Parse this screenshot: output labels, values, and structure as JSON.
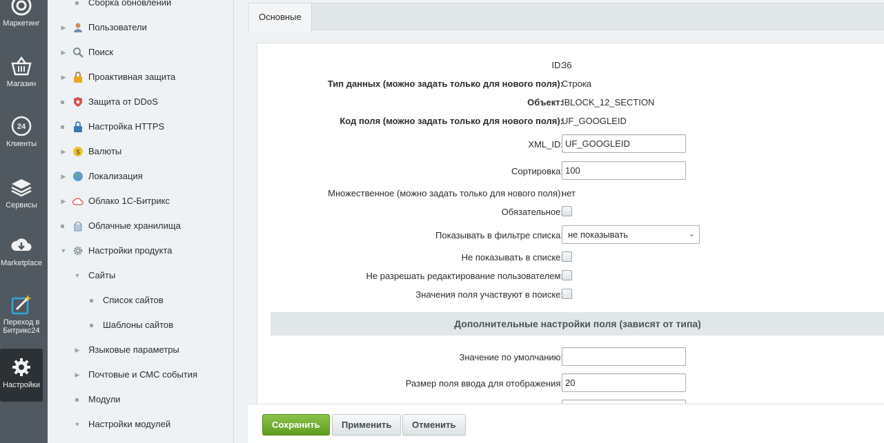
{
  "rail": [
    {
      "label": "Маркетинг",
      "icon": "target-icon"
    },
    {
      "label": "Магазин",
      "icon": "basket-icon"
    },
    {
      "label": "Клиенты",
      "icon": "clients-24-icon"
    },
    {
      "label": "Сервисы",
      "icon": "layers-icon"
    },
    {
      "label": "Marketplace",
      "icon": "cloud-download-icon"
    },
    {
      "label_line1": "Переход в",
      "label_line2": "Битрикс24",
      "icon": "magic-wand-icon"
    },
    {
      "label": "Настройки",
      "icon": "gear-icon",
      "active": true
    }
  ],
  "tree": [
    {
      "label": "Сборка обновлений"
    },
    {
      "label": "Пользователи"
    },
    {
      "label": "Поиск"
    },
    {
      "label": "Проактивная защита"
    },
    {
      "label": "Защита от DDoS"
    },
    {
      "label": "Настройка HTTPS"
    },
    {
      "label": "Валюты"
    },
    {
      "label": "Локализация"
    },
    {
      "label": "Облако 1С-Битрикс"
    },
    {
      "label": "Облачные хранилища"
    },
    {
      "label": "Настройки продукта"
    },
    {
      "label": "Сайты"
    },
    {
      "label": "Список сайтов"
    },
    {
      "label": "Шаблоны сайтов"
    },
    {
      "label": "Языковые параметры"
    },
    {
      "label": "Почтовые и СМС события"
    },
    {
      "label": "Модули"
    },
    {
      "label": "Настройки модулей"
    }
  ],
  "tabs": [
    {
      "label": "Основные"
    }
  ],
  "form": {
    "id_label": "ID:",
    "id_value": "36",
    "type_label": "Тип данных (можно задать только для нового поля):",
    "type_value": "Строка",
    "object_label": "Объект:",
    "object_value": "IBLOCK_12_SECTION",
    "code_label": "Код поля (можно задать только для нового поля):",
    "code_value": "UF_GOOGLEID",
    "xmlid_label": "XML_ID:",
    "xmlid_value": "UF_GOOGLEID",
    "sort_label": "Сортировка:",
    "sort_value": "100",
    "multiple_label": "Множественное (можно задать только для нового поля):",
    "multiple_value": "нет",
    "required_label": "Обязательное:",
    "filter_label": "Показывать в фильтре списка:",
    "filter_value": "не показывать",
    "hide_list_label": "Не показывать в списке:",
    "no_edit_label": "Не разрешать редактирование пользователем:",
    "search_label": "Значения поля участвуют в поиске:",
    "section_title": "Дополнительные настройки поля (зависят от типа)",
    "default_label": "Значение по умолчанию:",
    "default_value": "",
    "size_label": "Размер поля ввода для отображения:",
    "size_value": "20"
  },
  "footer": {
    "save": "Сохранить",
    "apply": "Применить",
    "cancel": "Отменить"
  }
}
